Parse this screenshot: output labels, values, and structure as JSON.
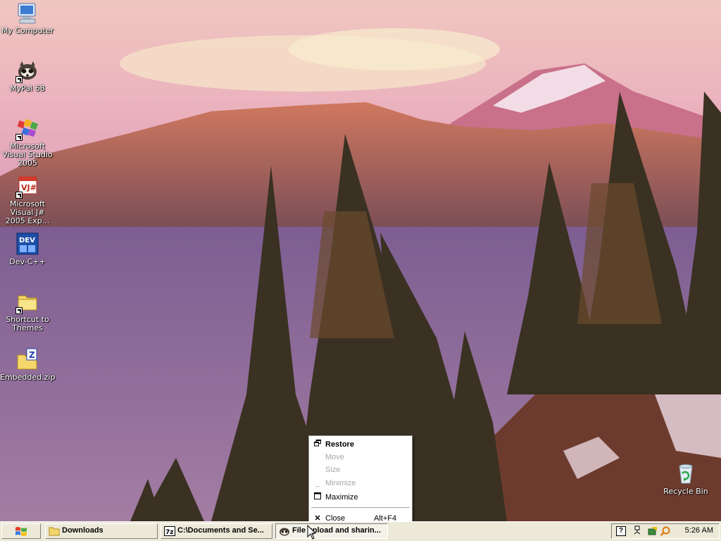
{
  "desktop": {
    "icons": [
      {
        "label": "My Computer"
      },
      {
        "label": "MyPal 68"
      },
      {
        "label": "Microsoft Visual Studio 2005"
      },
      {
        "label": "Microsoft Visual J# 2005 Exp..."
      },
      {
        "label": "Dev-C++"
      },
      {
        "label": "Shortcut to Themes"
      },
      {
        "label": "Embedded.zip"
      },
      {
        "label": "Recycle Bin"
      }
    ]
  },
  "context_menu": {
    "items": [
      {
        "glyph": "restore-icon",
        "label": "Restore",
        "enabled": true,
        "default": true
      },
      {
        "glyph": "",
        "label": "Move",
        "enabled": false
      },
      {
        "glyph": "",
        "label": "Size",
        "enabled": false
      },
      {
        "glyph": "minimize-icon",
        "label": "Minimize",
        "enabled": false
      },
      {
        "glyph": "maximize-icon",
        "label": "Maximize",
        "enabled": true
      },
      {
        "glyph": "close-icon",
        "label": "Close",
        "shortcut": "Alt+F4",
        "enabled": true
      }
    ]
  },
  "taskbar": {
    "start_icon": "windows-logo-icon",
    "buttons": [
      {
        "icon": "folder-icon",
        "label": "Downloads"
      },
      {
        "icon": "7zip-icon",
        "label": "C:\\Documents and Se..."
      },
      {
        "icon": "mypal-icon",
        "label": "File upload and sharin..."
      }
    ],
    "tray_icons": [
      "help-icon",
      "network-icon",
      "safely-remove-hardware-icon",
      "search-icon"
    ],
    "clock": "5:26 AM"
  },
  "colors": {
    "taskbar": "#ece9d8",
    "sky": "#e9a4bd",
    "lake": "#8b6a9c"
  }
}
